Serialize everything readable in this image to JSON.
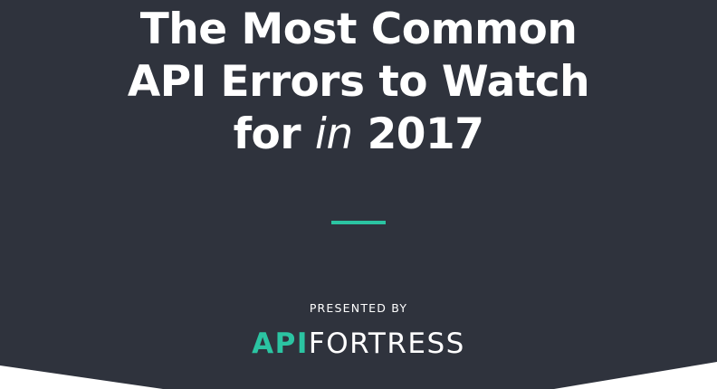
{
  "hero": {
    "title_line1": "The Most Common",
    "title_line2": "API Errors to Watch",
    "title_line3_prefix": "for ",
    "title_line3_italic": "in",
    "title_line3_suffix": " 2017",
    "presented_by": "PRESENTED BY",
    "logo_api": "API",
    "logo_fortress": "FORTRESS"
  },
  "colors": {
    "background": "#2f333d",
    "accent": "#2bc4a2",
    "text": "#ffffff"
  }
}
